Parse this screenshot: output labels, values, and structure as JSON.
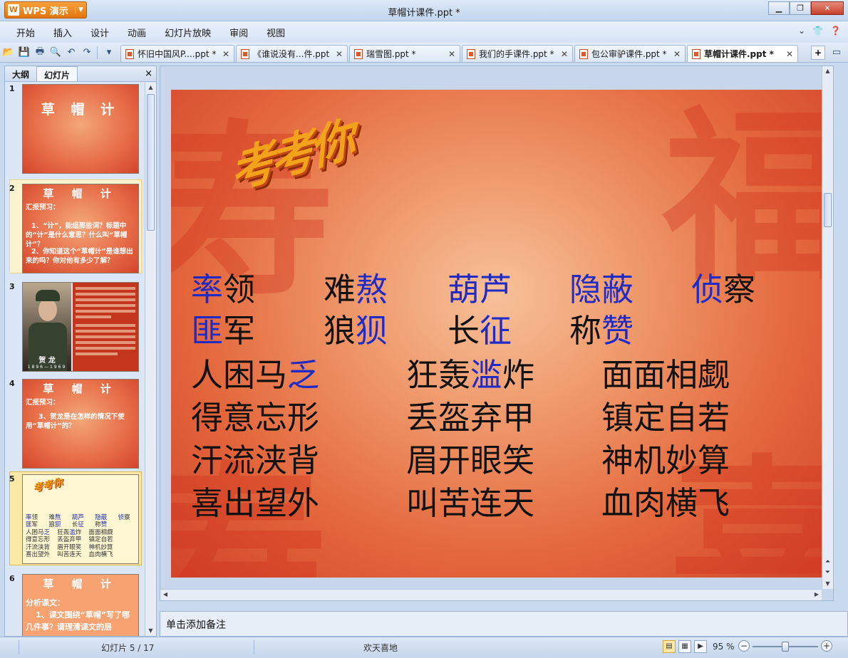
{
  "app": {
    "name": "WPS 演示",
    "window_title": "草帽计课件.ppt *"
  },
  "menu": [
    "开始",
    "插入",
    "设计",
    "动画",
    "幻灯片放映",
    "审阅",
    "视图"
  ],
  "doc_tabs": [
    {
      "label": "怀旧中国风P....ppt *",
      "active": false
    },
    {
      "label": "《谁说没有...件.ppt",
      "active": false
    },
    {
      "label": "瑞雪图.ppt *",
      "active": false
    },
    {
      "label": "我们的手课件.ppt *",
      "active": false
    },
    {
      "label": "包公审驴课件.ppt *",
      "active": false
    },
    {
      "label": "草帽计课件.ppt *",
      "active": true
    }
  ],
  "left_panel": {
    "tabs": [
      "大纲",
      "幻灯片"
    ],
    "active_tab": "幻灯片",
    "close_label": "×",
    "scroll_position": 0.18,
    "thumbnails": [
      {
        "num": "1",
        "title": "草 帽 计"
      },
      {
        "num": "2",
        "title": "草 帽 计",
        "heading": "汇报预习：",
        "lines": [
          "1、“计”，能组那些词？标题中的“计”是什么意思？什么叫“草帽计”？",
          "2、你知道这个“草帽计”是谁想出来的吗？你对他有多少了解？"
        ]
      },
      {
        "num": "3",
        "name": "贺 龙",
        "years": "1896—1969"
      },
      {
        "num": "4",
        "title": "草 帽 计",
        "heading": "汇报预习：",
        "lines": [
          "3、贺龙是在怎样的情况下使用“草帽计”的？"
        ]
      },
      {
        "num": "5",
        "title": "考考你",
        "selected": true
      },
      {
        "num": "6",
        "title": "草 帽 计",
        "heading": "分析课文：",
        "lines": [
          "1、课文围绕“草帽”写了哪几件事？请理清课文的层"
        ]
      }
    ]
  },
  "slide": {
    "title": "考考你",
    "background_glyphs": [
      "寿",
      "福",
      "寿",
      "喜"
    ],
    "words_row1": [
      [
        "率",
        "领"
      ],
      [
        "难",
        "熬"
      ],
      [
        "葫芦",
        ""
      ],
      [
        "隐蔽",
        ""
      ],
      [
        "侦",
        "察"
      ]
    ],
    "words_row1_hl": [
      [
        true,
        false
      ],
      [
        false,
        true
      ],
      [
        true,
        false
      ],
      [
        true,
        false
      ],
      [
        true,
        false
      ]
    ],
    "words_row2": [
      [
        "匪",
        "军"
      ],
      [
        "狼",
        "狈"
      ],
      [
        "长",
        "征"
      ],
      [
        "称",
        "赞"
      ]
    ],
    "words_row2_hl": [
      [
        true,
        false
      ],
      [
        false,
        true
      ],
      [
        false,
        true
      ],
      [
        false,
        true
      ]
    ],
    "idioms": [
      [
        [
          "人困马",
          "乏"
        ],
        [
          "狂轰",
          "滥",
          "炸"
        ],
        [
          "面面相觑"
        ]
      ],
      [
        [
          "得意忘形"
        ],
        [
          "丢盔弃甲"
        ],
        [
          "镇定自若"
        ]
      ],
      [
        [
          "汗流浃背"
        ],
        [
          "眉开眼笑"
        ],
        [
          "神机妙算"
        ]
      ],
      [
        [
          "喜出望外"
        ],
        [
          "叫苦连天"
        ],
        [
          "血肉横飞"
        ]
      ]
    ]
  },
  "notes_placeholder": "单击添加备注",
  "status": {
    "slide_label": "幻灯片 5 / 17",
    "theme": "欢天喜地",
    "zoom_label": "95 %",
    "zoom_value": 0.5
  },
  "colors": {
    "highlight": "#1f2bc4",
    "text": "#111111",
    "accent": "#e2750d"
  }
}
